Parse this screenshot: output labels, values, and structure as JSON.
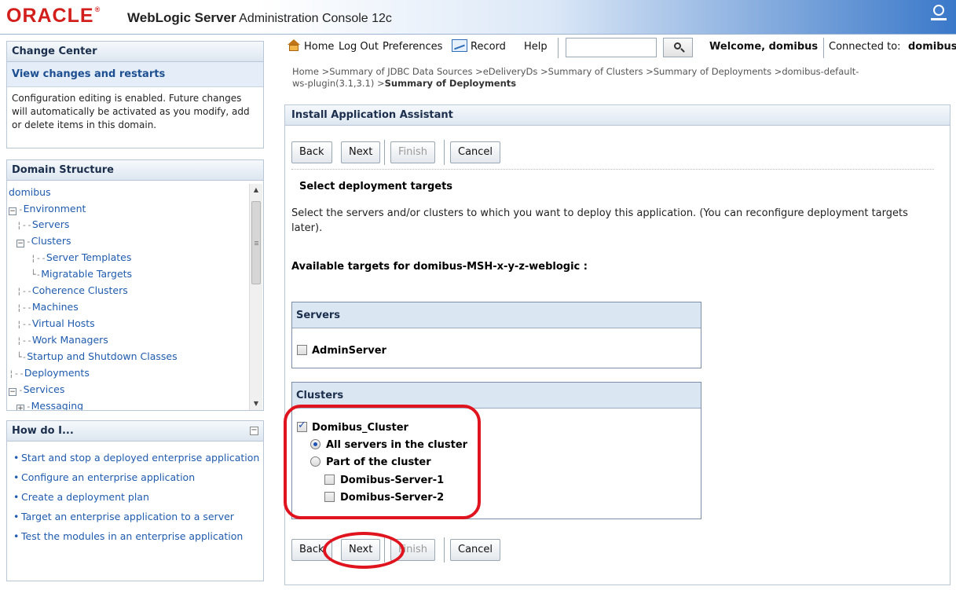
{
  "header": {
    "brand": "ORACLE",
    "product_bold": "WebLogic Server",
    "product_rest": "Administration Console 12c"
  },
  "toolbar": {
    "home": "Home",
    "logout": "Log Out",
    "preferences": "Preferences",
    "record": "Record",
    "help": "Help",
    "search_value": "",
    "welcome": "Welcome, domibus",
    "connected_label": "Connected to:",
    "connected_domain": "domibus"
  },
  "breadcrumb": {
    "line1": "Home >Summary of JDBC Data Sources >eDeliveryDs >Summary of Clusters >Summary of Deployments >domibus-default-",
    "line2": "ws-plugin(3.1,3.1) >",
    "current": "Summary of Deployments"
  },
  "change_center": {
    "title": "Change Center",
    "link": "View changes and restarts",
    "text": "Configuration editing is enabled. Future changes will automatically be activated as you modify, add or delete items in this domain."
  },
  "domain_structure": {
    "title": "Domain Structure",
    "nodes": {
      "root": "domibus",
      "environment": "Environment",
      "servers": "Servers",
      "clusters": "Clusters",
      "server_templates": "Server Templates",
      "migratable_targets": "Migratable Targets",
      "coherence_clusters": "Coherence Clusters",
      "machines": "Machines",
      "virtual_hosts": "Virtual Hosts",
      "work_managers": "Work Managers",
      "startup_shutdown": "Startup and Shutdown Classes",
      "deployments": "Deployments",
      "services": "Services",
      "messaging": "Messaging"
    }
  },
  "how_do_i": {
    "title": "How do I...",
    "items": [
      "Start and stop a deployed enterprise application",
      "Configure an enterprise application",
      "Create a deployment plan",
      "Target an enterprise application to a server",
      "Test the modules in an enterprise application"
    ]
  },
  "assistant": {
    "title": "Install Application Assistant",
    "buttons": {
      "back": "Back",
      "next": "Next",
      "finish": "Finish",
      "cancel": "Cancel"
    },
    "section_title": "Select deployment targets",
    "description": "Select the servers and/or clusters to which you want to deploy this application. (You can reconfigure deployment targets later).",
    "available_label": "Available targets for domibus-MSH-x-y-z-weblogic :",
    "servers_box": {
      "title": "Servers",
      "admin_server": "AdminServer",
      "admin_checked": false
    },
    "clusters_box": {
      "title": "Clusters",
      "cluster_name": "Domibus_Cluster",
      "cluster_checked": true,
      "all_servers": "All servers in the cluster",
      "all_selected": true,
      "part_of_cluster": "Part of the cluster",
      "part_selected": false,
      "server1": "Domibus-Server-1",
      "server2": "Domibus-Server-2"
    }
  },
  "colors": {
    "oracle_red": "#d21f1b",
    "link_blue": "#1f5bae",
    "header_blue": "#dbe6f3",
    "annotation_red": "#e0141e"
  }
}
